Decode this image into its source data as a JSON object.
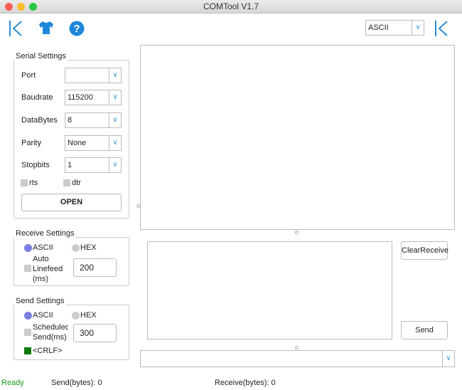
{
  "window": {
    "title": "COMTool V1.7"
  },
  "toolbar": {
    "collapse_left_icon": "collapse-left-icon",
    "skin_icon": "tshirt-icon",
    "help_icon": "help-icon",
    "encoding": "ASCII",
    "collapse_right_icon": "collapse-right-icon"
  },
  "serial": {
    "title": "Serial Settings",
    "port_label": "Port",
    "port_value": "",
    "baud_label": "Baudrate",
    "baud_value": "115200",
    "databytes_label": "DataBytes",
    "databytes_value": "8",
    "parity_label": "Parity",
    "parity_value": "None",
    "stopbits_label": "Stopbits",
    "stopbits_value": "1",
    "rts": "rts",
    "dtr": "dtr",
    "rts_checked": false,
    "dtr_checked": false,
    "open_label": "OPEN"
  },
  "receive": {
    "title": "Receive Settings",
    "ascii": "ASCII",
    "hex": "HEX",
    "mode": "ASCII",
    "auto_linefeed": "Auto Linefeed (ms)",
    "auto_linefeed_checked": false,
    "linefeed_ms": "200"
  },
  "send": {
    "title": "Send Settings",
    "ascii": "ASCII",
    "hex": "HEX",
    "mode": "ASCII",
    "scheduled": "Scheduled Send(ms)",
    "scheduled_checked": false,
    "scheduled_ms": "300",
    "crlf": "<CRLF>",
    "crlf_checked": true
  },
  "buttons": {
    "clear_receive": "ClearReceive",
    "send": "Send"
  },
  "status": {
    "state": "Ready",
    "send_bytes": "Send(bytes): 0",
    "receive_bytes": "Receive(bytes): 0"
  },
  "colors": {
    "accent": "#2b8fd6",
    "radio_on": "#7a7ee0",
    "ready": "#1a9a1a",
    "crlf_on": "#0a7a0a"
  }
}
